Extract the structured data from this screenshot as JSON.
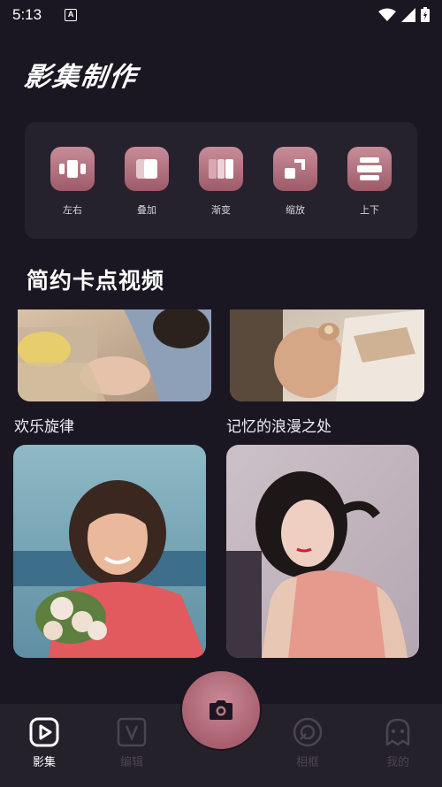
{
  "status_bar": {
    "time": "5:13",
    "notification_letter": "A"
  },
  "header": {
    "title": "影集制作"
  },
  "transitions": [
    {
      "label": "左右",
      "icon": "left-right-split-icon"
    },
    {
      "label": "叠加",
      "icon": "overlay-icon"
    },
    {
      "label": "渐变",
      "icon": "gradient-icon"
    },
    {
      "label": "缩放",
      "icon": "zoom-icon"
    },
    {
      "label": "上下",
      "icon": "top-bottom-split-icon"
    }
  ],
  "section": {
    "title": "简约卡点视频"
  },
  "videos": [
    {
      "label": "欢乐旋律"
    },
    {
      "label": "记忆的浪漫之处"
    }
  ],
  "nav": {
    "items": [
      {
        "label": "影集",
        "icon": "play-square-icon",
        "active": true
      },
      {
        "label": "编辑",
        "icon": "edit-v-icon",
        "active": false
      },
      {
        "label": "相框",
        "icon": "frame-icon",
        "active": false
      },
      {
        "label": "我的",
        "icon": "profile-ghost-icon",
        "active": false
      }
    ],
    "camera_icon": "camera-icon"
  },
  "colors": {
    "background": "#1b1722",
    "panel": "#26222d",
    "accent": "#b87581",
    "nav_bg": "#25212b",
    "nav_inactive": "#4a4552"
  }
}
